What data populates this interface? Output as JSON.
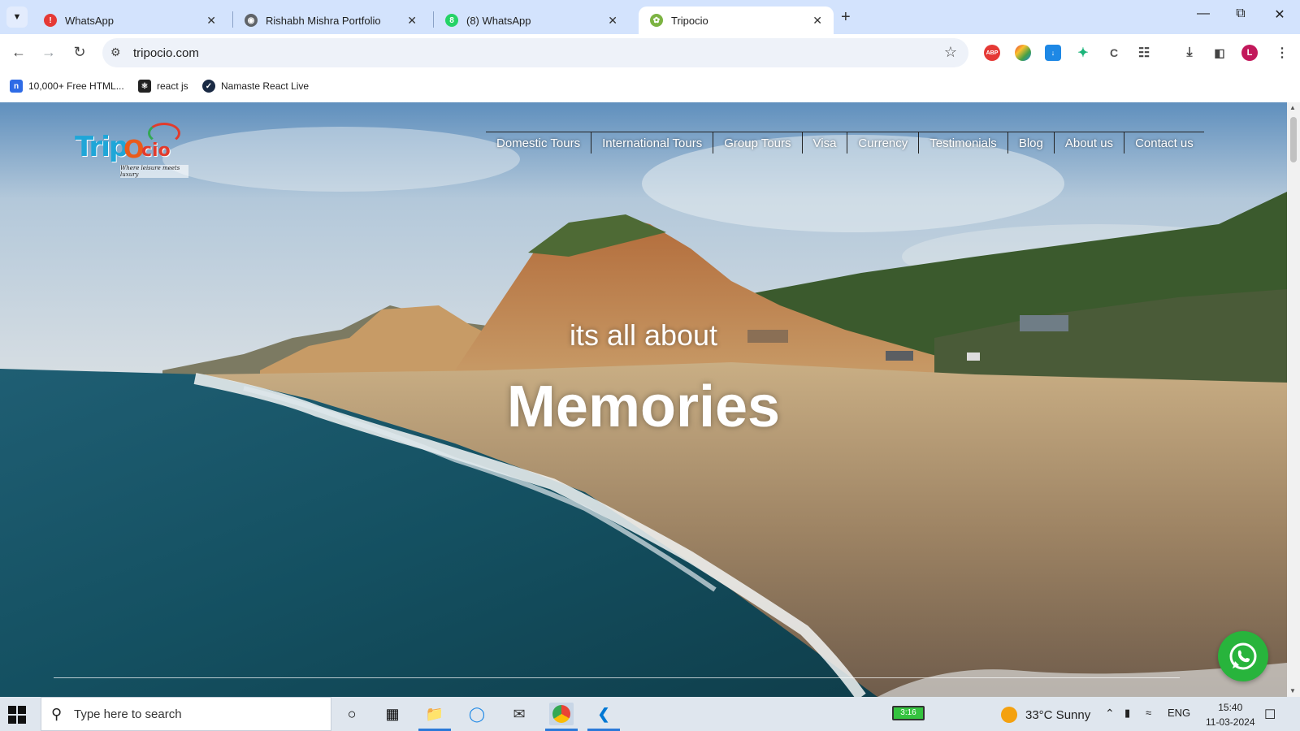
{
  "browser": {
    "tabs": [
      {
        "title": "WhatsApp",
        "favicon": "whatsapp-alert-icon",
        "active": false
      },
      {
        "title": "Rishabh Mishra Portfolio",
        "favicon": "globe-icon",
        "active": false
      },
      {
        "title": "(8) WhatsApp",
        "favicon": "whatsapp-icon",
        "active": false
      },
      {
        "title": "Tripocio",
        "favicon": "tripocio-icon",
        "active": true
      }
    ],
    "url": "tripocio.com",
    "bookmarks": [
      {
        "label": "10,000+ Free HTML...",
        "icon": "n-icon"
      },
      {
        "label": "react js",
        "icon": "react-icon"
      },
      {
        "label": "Namaste React Live",
        "icon": "namaste-icon"
      }
    ],
    "extensions": [
      "abp-icon",
      "color-icon",
      "download-ext-icon",
      "sparkle-icon",
      "code-icon",
      "puzzle-icon"
    ],
    "profile_initial": "L",
    "extension_labels": {
      "abp": "ABP"
    },
    "colors": {
      "tabstrip": "#d3e3fd",
      "profile": "#c2185b"
    }
  },
  "site": {
    "logo": {
      "main": "Trip",
      "accent": "cio",
      "mid": "O",
      "tagline": "Where leisure meets luxury"
    },
    "nav": [
      "Domestic Tours",
      "International Tours",
      "Group Tours",
      "Visa",
      "Currency",
      "Testimonials",
      "Blog",
      "About us",
      "Contact us"
    ],
    "hero_subtitle": "its all about",
    "hero_title": "Memories",
    "floating_button": "whatsapp-icon"
  },
  "taskbar": {
    "search_placeholder": "Type here to search",
    "battery_label": "3:16",
    "weather": "33°C  Sunny",
    "language": "ENG",
    "time": "15:40",
    "date": "11-03-2024"
  }
}
